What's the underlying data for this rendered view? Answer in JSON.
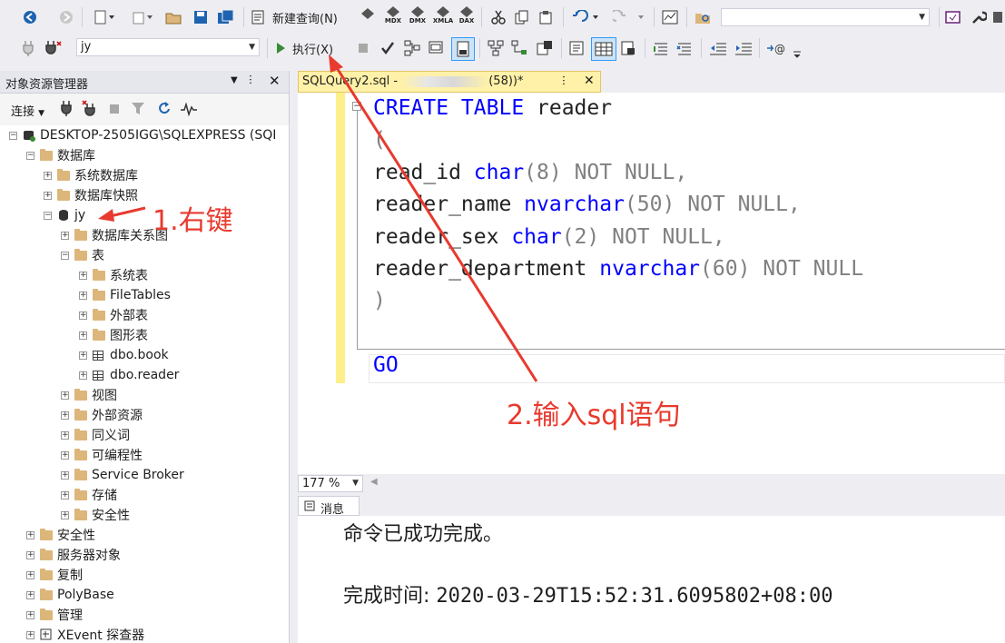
{
  "toolbar": {
    "new_query_label": "新建查询(N)",
    "execute_label": "执行(X)",
    "mdx_label": "MDX",
    "dmx_label": "DMX",
    "xmla_label": "XMLA",
    "dax_label": "DAX",
    "database_value": "jy",
    "search_value": ""
  },
  "object_explorer": {
    "title": "对象资源管理器",
    "connect_label": "连接",
    "tree": [
      {
        "label": "DESKTOP-2505IGG\\SQLEXPRESS (SQI",
        "level": 0,
        "expanded": true,
        "icon": "server-icon"
      },
      {
        "label": "数据库",
        "level": 1,
        "expanded": true,
        "icon": "folder-icon"
      },
      {
        "label": "系统数据库",
        "level": 2,
        "expanded": false,
        "icon": "folder-icon"
      },
      {
        "label": "数据库快照",
        "level": 2,
        "expanded": false,
        "icon": "folder-icon"
      },
      {
        "label": "jy",
        "level": 2,
        "expanded": true,
        "icon": "database-icon"
      },
      {
        "label": "数据库关系图",
        "level": 3,
        "expanded": false,
        "icon": "folder-icon"
      },
      {
        "label": "表",
        "level": 3,
        "expanded": true,
        "icon": "folder-icon"
      },
      {
        "label": "系统表",
        "level": 4,
        "expanded": false,
        "icon": "folder-icon"
      },
      {
        "label": "FileTables",
        "level": 4,
        "expanded": false,
        "icon": "folder-icon"
      },
      {
        "label": "外部表",
        "level": 4,
        "expanded": false,
        "icon": "folder-icon"
      },
      {
        "label": "图形表",
        "level": 4,
        "expanded": false,
        "icon": "folder-icon"
      },
      {
        "label": "dbo.book",
        "level": 4,
        "expanded": false,
        "icon": "table-icon"
      },
      {
        "label": "dbo.reader",
        "level": 4,
        "expanded": false,
        "icon": "table-icon"
      },
      {
        "label": "视图",
        "level": 3,
        "expanded": false,
        "icon": "folder-icon"
      },
      {
        "label": "外部资源",
        "level": 3,
        "expanded": false,
        "icon": "folder-icon"
      },
      {
        "label": "同义词",
        "level": 3,
        "expanded": false,
        "icon": "folder-icon"
      },
      {
        "label": "可编程性",
        "level": 3,
        "expanded": false,
        "icon": "folder-icon"
      },
      {
        "label": "Service Broker",
        "level": 3,
        "expanded": false,
        "icon": "folder-icon"
      },
      {
        "label": "存储",
        "level": 3,
        "expanded": false,
        "icon": "folder-icon"
      },
      {
        "label": "安全性",
        "level": 3,
        "expanded": false,
        "icon": "folder-icon"
      },
      {
        "label": "安全性",
        "level": 1,
        "expanded": false,
        "icon": "folder-icon"
      },
      {
        "label": "服务器对象",
        "level": 1,
        "expanded": false,
        "icon": "folder-icon"
      },
      {
        "label": "复制",
        "level": 1,
        "expanded": false,
        "icon": "folder-icon"
      },
      {
        "label": "PolyBase",
        "level": 1,
        "expanded": false,
        "icon": "folder-icon"
      },
      {
        "label": "管理",
        "level": 1,
        "expanded": false,
        "icon": "folder-icon"
      },
      {
        "label": "XEvent 探查器",
        "level": 1,
        "expanded": false,
        "icon": "xevent-icon"
      }
    ]
  },
  "editor": {
    "tab_title_left": "SQLQuery2.sql - ",
    "tab_title_right": "(58))*",
    "code": {
      "l1_kw": "CREATE TABLE",
      "l1_name": " reader",
      "l2": "(",
      "l3_a": "read_id ",
      "l3_kw": "char",
      "l3_b": "(8) ",
      "l3_c": "NOT NULL,",
      "l4_a": "reader_name ",
      "l4_kw": "nvarchar",
      "l4_b": "(50) ",
      "l4_c": "NOT NULL,",
      "l5_a": "reader_sex ",
      "l5_kw": "char",
      "l5_b": "(2) ",
      "l5_c": "NOT NULL,",
      "l6_a": "reader_department ",
      "l6_kw": "nvarchar",
      "l6_b": "(60) ",
      "l6_c": "NOT NULL",
      "l7": ")",
      "l9": "GO"
    },
    "zoom": "177 %"
  },
  "results": {
    "tab_label": "消息",
    "message": "命令已成功完成。",
    "completion_label": "完成时间: ",
    "completion_time": "2020-03-29T15:52:31.6095802+08:00"
  },
  "annotations": {
    "step1": "1.右键",
    "step2": "2.输入sql语句",
    "color": "#e83a2e"
  }
}
